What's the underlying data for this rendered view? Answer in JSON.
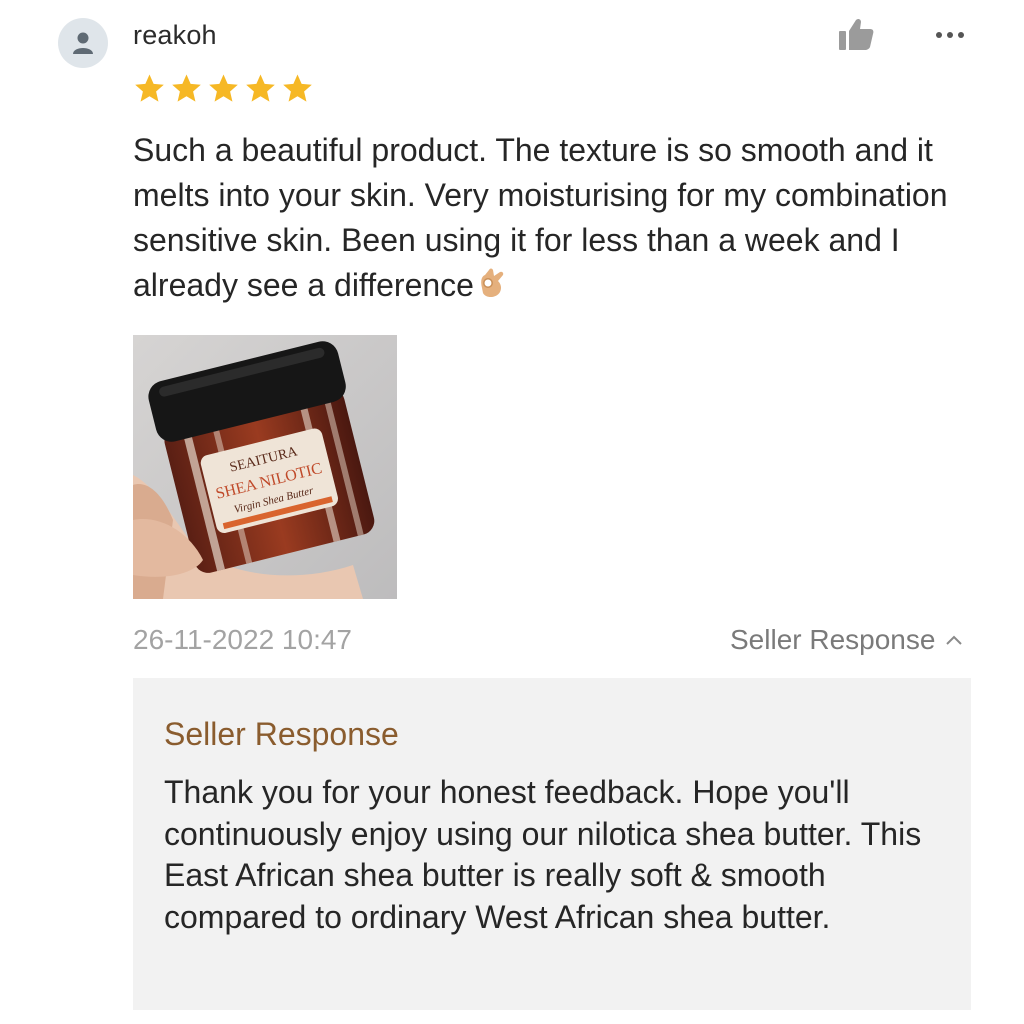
{
  "review": {
    "username": "reakoh",
    "rating": 5,
    "rating_max": 5,
    "text": "Such a beautiful product. The texture is so smooth and it melts into your skin. Very moisturising for my combination sensitive skin. Been using it for less than a week and I already see a difference",
    "emoji": "👌",
    "timestamp": "26-11-2022 10:47",
    "photo": {
      "icon": "product-jar-photo",
      "brand_text": "SEAITURA",
      "product_text": "SHEA NILOTIC",
      "subtitle_text": "Virgin Shea Butter"
    }
  },
  "icons": {
    "avatar": "user-avatar-icon",
    "like": "thumbs-up-icon",
    "more": "more-options-icon",
    "chevron": "chevron-up-icon",
    "star": "star-icon"
  },
  "seller_response": {
    "toggle_label": "Seller Response",
    "title": "Seller Response",
    "text": "Thank you for your honest feedback. Hope you'll continuously enjoy using our nilotica shea butter. This East African shea butter is really soft & smooth compared to ordinary West African shea butter."
  },
  "colors": {
    "star": "#f6b825",
    "seller_title": "#8a5c2e",
    "seller_box_bg": "#f2f2f2",
    "timestamp": "#a3a3a3",
    "avatar_bg": "#dfe5ea"
  }
}
